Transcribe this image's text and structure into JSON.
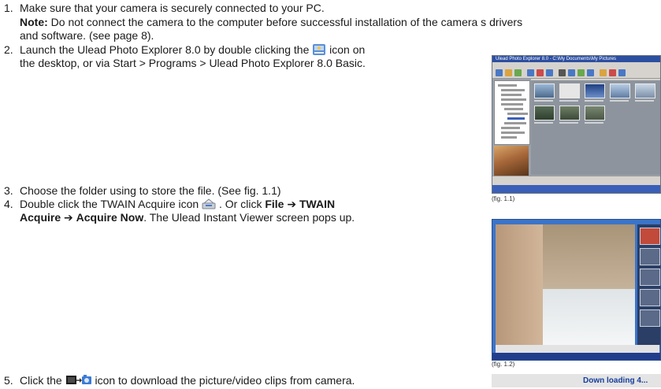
{
  "steps": [
    {
      "num": "1.",
      "text": "Make sure that your camera is securely connected to your PC."
    },
    {
      "num": "2.",
      "text_a": "Launch the Ulead Photo Explorer 8.0 by double clicking the",
      "text_b": "icon on",
      "text_c": "the desktop, or via Start > Programs > Ulead Photo Explorer 8.0 Basic."
    },
    {
      "num": "3.",
      "text": "Choose the folder using to store the file. (See fig. 1.1)"
    },
    {
      "num": "4.",
      "text_a": "Double click the TWAIN Acquire icon",
      "text_b": ". Or click",
      "file": "File",
      "twain": "TWAIN",
      "acquire": "Acquire",
      "acquire_now": "Acquire Now",
      "text_c": ". The Ulead Instant Viewer screen pops up."
    },
    {
      "num": "5.",
      "text_a": "Click the",
      "text_b": "icon to download the picture/video clips from camera."
    }
  ],
  "note": {
    "label": "Note:",
    "text": "Do not connect the camera to the computer before successful installation of the camera s drivers",
    "text2": "and software. (see page 8)."
  },
  "arrow": "➔",
  "fig1": {
    "caption": "(fig. 1.1)",
    "title": "Ulead Photo Explorer 8.0 - C:\\My Documents\\My Pictures"
  },
  "fig2": {
    "caption": "(fig. 1.2)"
  },
  "fig3": {
    "status": "Down loading  4..."
  },
  "icons": {
    "desktop": "ulead-desktop-icon",
    "twain": "twain-acquire-icon",
    "download": "camera-download-icon"
  }
}
